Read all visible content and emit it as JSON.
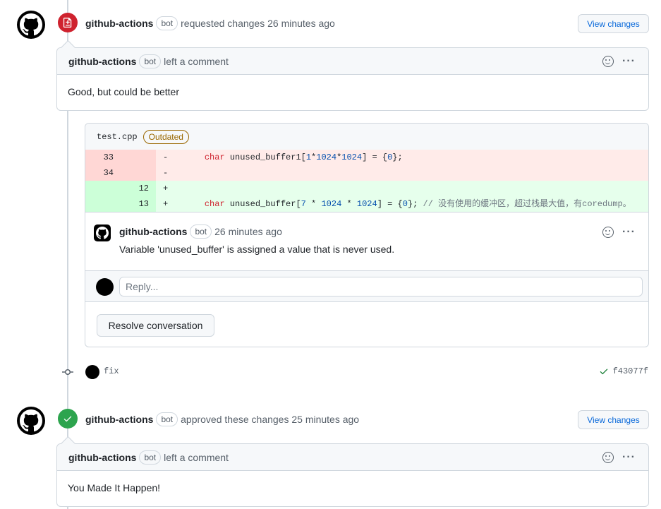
{
  "reviews": [
    {
      "author": "github-actions",
      "bot_label": "bot",
      "action": "requested changes 26 minutes ago",
      "state": "changes_requested",
      "state_color": "#cf222e",
      "view_changes_label": "View changes",
      "comment": {
        "author": "github-actions",
        "bot_label": "bot",
        "action": "left a comment",
        "body": "Good, but could be better"
      },
      "thread": {
        "file": "test.cpp",
        "outdated_label": "Outdated",
        "diff": [
          {
            "type": "del",
            "old": "33",
            "new": "",
            "sign": "-",
            "kw": "char",
            "pre": " unused_buffer1[",
            "n1": "1",
            "op1": "*",
            "n2": "1024",
            "op2": "*",
            "n3": "1024",
            "post": "] = {",
            "n4": "0",
            "end": "};",
            "comment": ""
          },
          {
            "type": "del",
            "old": "34",
            "new": "",
            "sign": "-"
          },
          {
            "type": "add",
            "old": "",
            "new": "12",
            "sign": "+"
          },
          {
            "type": "add",
            "old": "",
            "new": "13",
            "sign": "+",
            "kw": "char",
            "pre": " unused_buffer[",
            "n1": "7",
            "op1": " * ",
            "n2": "1024",
            "op2": " * ",
            "n3": "1024",
            "post": "] = {",
            "n4": "0",
            "end": "}; ",
            "comment": "// 没有使用的缓冲区，超过栈最大值，有coredump。"
          }
        ],
        "inline_comment": {
          "author": "github-actions",
          "bot_label": "bot",
          "time": "26 minutes ago",
          "body": "Variable 'unused_buffer' is assigned a value that is never used."
        },
        "reply_placeholder": "Reply...",
        "resolve_label": "Resolve conversation"
      }
    },
    {
      "author": "github-actions",
      "bot_label": "bot",
      "action": "approved these changes 25 minutes ago",
      "state": "approved",
      "state_color": "#2da44e",
      "view_changes_label": "View changes",
      "comment": {
        "author": "github-actions",
        "bot_label": "bot",
        "action": "left a comment",
        "body": "You Made It Happen!"
      }
    }
  ],
  "commit": {
    "message": "fix",
    "sha": "f43077f",
    "status": "success",
    "status_color": "#1a7f37"
  }
}
